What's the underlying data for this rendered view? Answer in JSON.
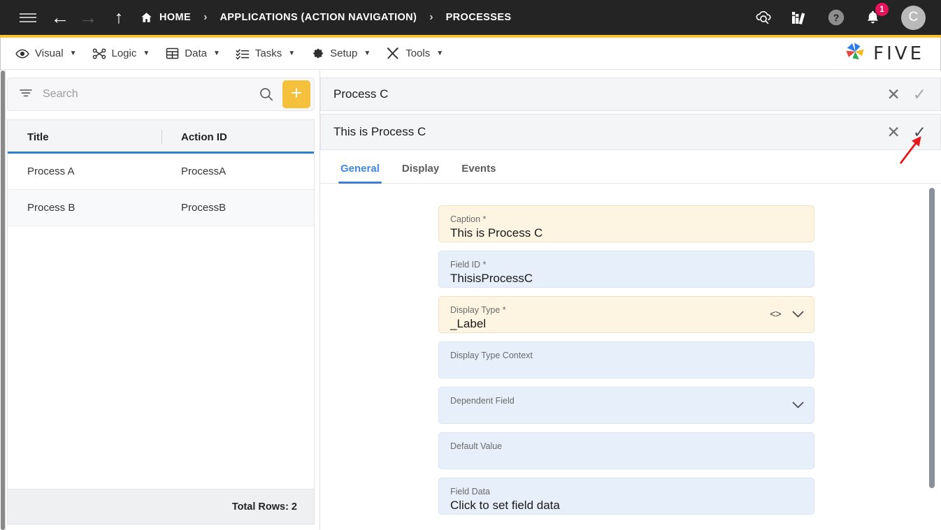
{
  "topbar": {
    "icons": {
      "hamburger": "hamburger-menu-icon",
      "back": "back-arrow-icon",
      "forward": "forward-arrow-icon",
      "up": "up-arrow-icon",
      "home": "home-icon",
      "cloud_search": "cloud-search-icon",
      "books": "books-library-icon",
      "help": "help-circle-icon",
      "bell": "notification-bell-icon"
    },
    "breadcrumbs": [
      {
        "label": "HOME"
      },
      {
        "label": "APPLICATIONS (ACTION NAVIGATION)"
      },
      {
        "label": "PROCESSES"
      }
    ],
    "separator": "›",
    "notification_count": "1",
    "avatar_initial": "C",
    "accent_color": "#f8c136",
    "background_color": "#242424",
    "badge_color": "#e8145b"
  },
  "menubar": {
    "items": [
      {
        "label": "Visual",
        "icon": "eye-icon",
        "caret": "▼"
      },
      {
        "label": "Logic",
        "icon": "logic-nodes-icon",
        "caret": "▼"
      },
      {
        "label": "Data",
        "icon": "table-grid-icon",
        "caret": "▼"
      },
      {
        "label": "Tasks",
        "icon": "tasks-list-icon",
        "caret": "▼"
      },
      {
        "label": "Setup",
        "icon": "gear-icon",
        "caret": "▼"
      },
      {
        "label": "Tools",
        "icon": "tools-wrench-icon",
        "caret": "▼"
      }
    ],
    "logo_text": "FIVE"
  },
  "left_panel": {
    "search": {
      "placeholder": "Search",
      "value": "",
      "filter_icon": "filter-icon",
      "search_icon": "search-icon"
    },
    "add_button_label": "+",
    "grid": {
      "columns": [
        "Title",
        "Action ID"
      ],
      "rows": [
        {
          "title": "Process A",
          "action_id": "ProcessA"
        },
        {
          "title": "Process B",
          "action_id": "ProcessB"
        }
      ],
      "footer": "Total Rows: 2"
    }
  },
  "right_panel": {
    "outer_header": {
      "title": "Process C",
      "close_label": "✕",
      "confirm_label": "✓"
    },
    "inner_header": {
      "title": "This is Process C",
      "close_label": "✕",
      "confirm_label": "✓"
    },
    "tabs": [
      {
        "label": "General",
        "active": true
      },
      {
        "label": "Display",
        "active": false
      },
      {
        "label": "Events",
        "active": false
      }
    ],
    "fields": [
      {
        "label": "Caption *",
        "value": "This is Process C",
        "style": "cream",
        "has_value": true,
        "icons": []
      },
      {
        "label": "Field ID *",
        "value": "ThisisProcessC",
        "style": "blue",
        "has_value": true,
        "icons": []
      },
      {
        "label": "Display Type *",
        "value": "_Label",
        "style": "cream",
        "has_value": true,
        "icons": [
          "code-brackets-icon",
          "chevron-down-icon"
        ]
      },
      {
        "label": "Display Type Context",
        "value": "",
        "style": "blue",
        "has_value": false,
        "icons": []
      },
      {
        "label": "Dependent Field",
        "value": "",
        "style": "blue",
        "has_value": false,
        "icons": [
          "chevron-down-icon"
        ]
      },
      {
        "label": "Default Value",
        "value": "",
        "style": "blue",
        "has_value": false,
        "icons": []
      },
      {
        "label": "Field Data",
        "value": "Click to set field data",
        "style": "blue",
        "has_value": true,
        "icons": []
      }
    ]
  },
  "annotation": {
    "arrow_color": "#e8171c",
    "points_to": "inner-header-confirm-check"
  }
}
